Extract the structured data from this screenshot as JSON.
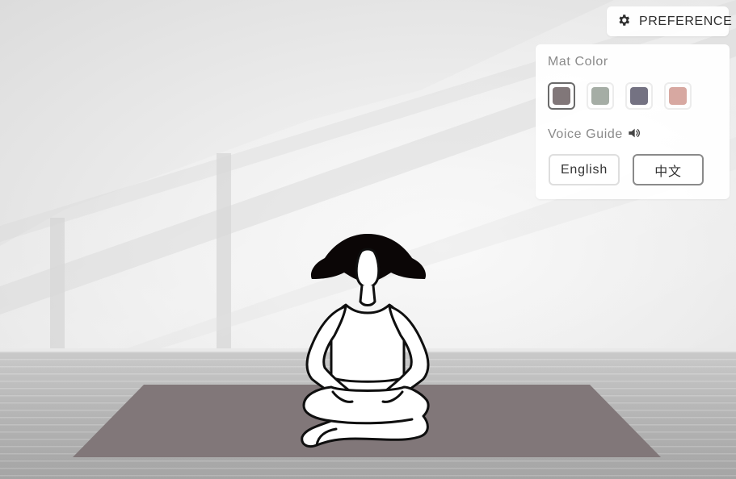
{
  "colors": {
    "mat_selected": "#817779",
    "mat_colors": [
      "#817779",
      "#A5ADA5",
      "#747282",
      "#D7A8A1"
    ],
    "panel_text": "#8a8a8a",
    "text_dark": "#333333",
    "figure_outline": "#0f0f0f",
    "hair": "#0b0606"
  },
  "preference": {
    "button_label": "PREFERENCE",
    "icon": "gear-icon",
    "mat_color_label": "Mat Color",
    "voice_guide_label": "Voice Guide",
    "voice_icon": "speaker-icon",
    "languages": {
      "english": "English",
      "chinese": "中文"
    }
  }
}
